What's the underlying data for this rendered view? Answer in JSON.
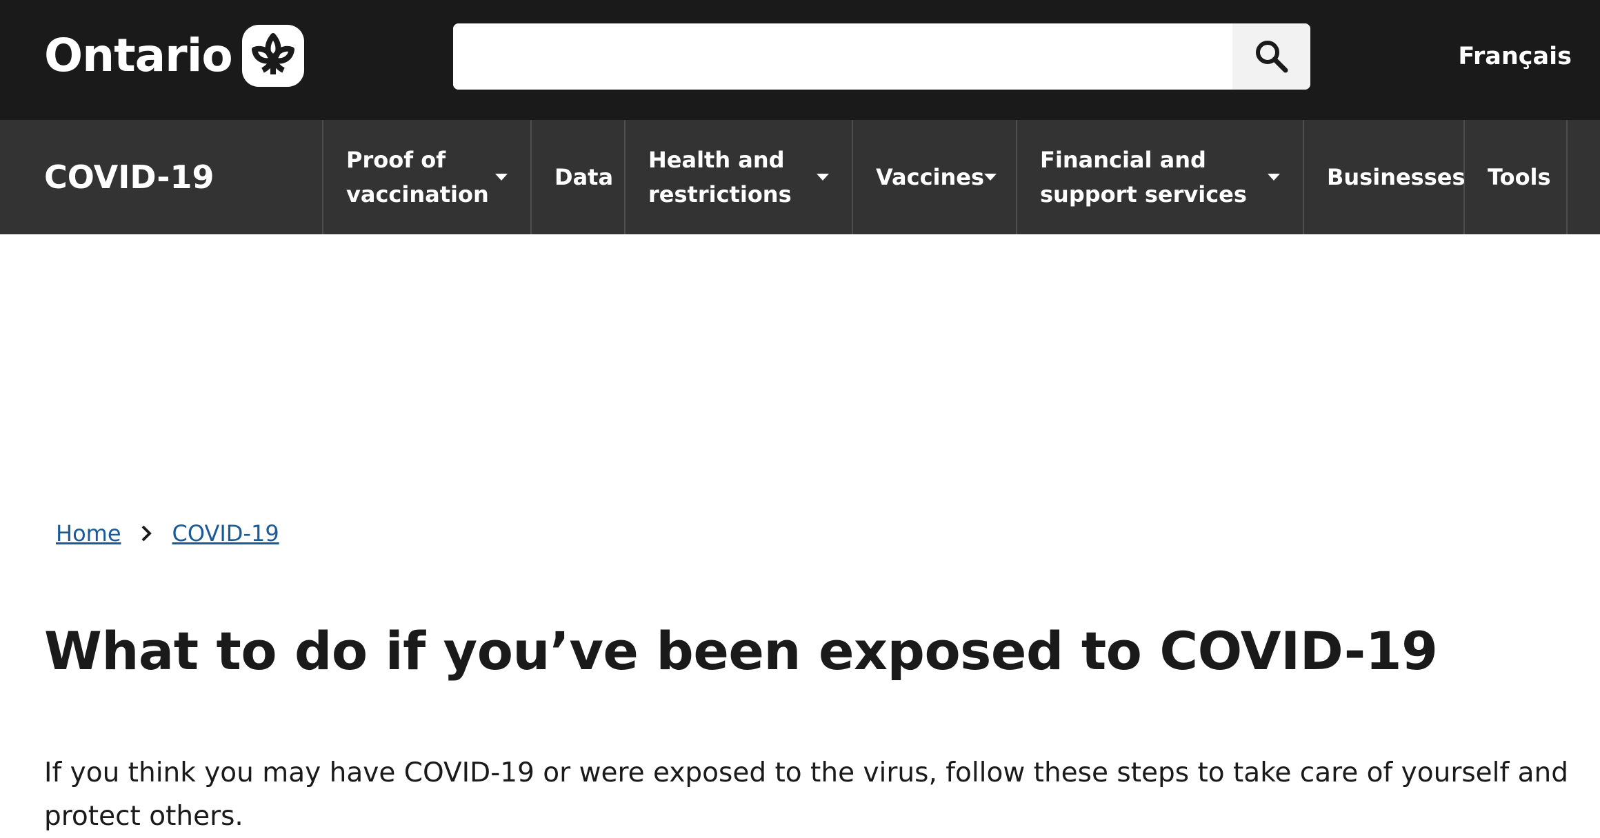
{
  "header": {
    "logo_text": "Ontario",
    "search": {
      "value": "",
      "placeholder": "",
      "button_icon": "search-icon"
    },
    "language_link": "Français"
  },
  "nav": {
    "site_title": "COVID-19",
    "items": [
      {
        "label": "Proof of vaccination",
        "has_dropdown": true
      },
      {
        "label": "Data",
        "has_dropdown": false
      },
      {
        "label": "Health and restrictions",
        "has_dropdown": true
      },
      {
        "label": "Vaccines",
        "has_dropdown": true
      },
      {
        "label": "Financial and support services",
        "has_dropdown": true
      },
      {
        "label": "Businesses",
        "has_dropdown": false
      },
      {
        "label": "Tools",
        "has_dropdown": false
      }
    ]
  },
  "breadcrumb": [
    {
      "label": "Home"
    },
    {
      "label": "COVID-19"
    }
  ],
  "page": {
    "title": "What to do if you’ve been exposed to COVID-19",
    "intro": "If you think you may have COVID-19 or were exposed to the virus, follow these steps to take care of yourself and protect others."
  },
  "colors": {
    "header_bg": "#1a1a1a",
    "nav_bg": "#333333",
    "link": "#1a5a96",
    "text": "#1a1a1a"
  }
}
